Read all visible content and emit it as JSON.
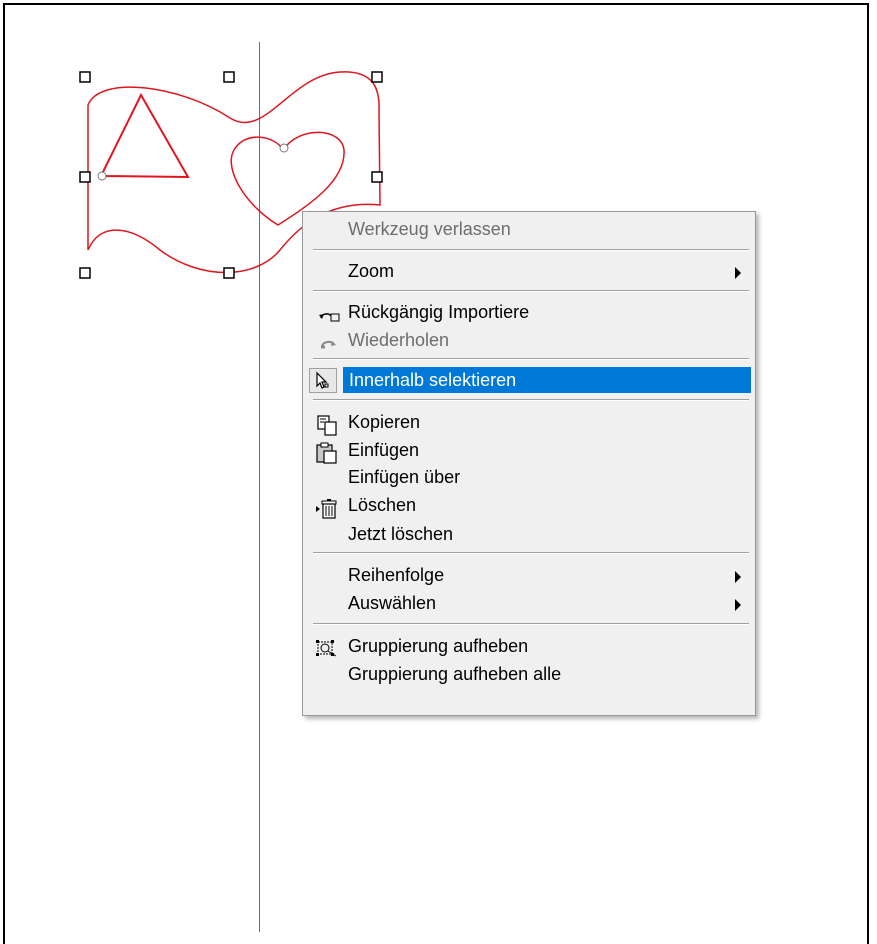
{
  "canvas": {
    "selection_color": "#e0161e",
    "handle_color": "#000000"
  },
  "context_menu": {
    "items": [
      {
        "label": "Werkzeug verlassen",
        "disabled": true
      },
      {
        "label": "Zoom",
        "submenu": true
      },
      {
        "label": "Rückgängig Importiere",
        "icon": "undo-icon"
      },
      {
        "label": "Wiederholen",
        "icon": "redo-icon",
        "disabled": true
      },
      {
        "label": "Innerhalb selektieren",
        "icon": "select-inside-icon",
        "highlighted": true
      },
      {
        "label": "Kopieren",
        "icon": "copy-icon"
      },
      {
        "label": "Einfügen",
        "icon": "paste-icon"
      },
      {
        "label": "Einfügen über"
      },
      {
        "label": "Löschen",
        "icon": "delete-icon"
      },
      {
        "label": "Jetzt löschen"
      },
      {
        "label": "Reihenfolge",
        "submenu": true
      },
      {
        "label": "Auswählen",
        "submenu": true
      },
      {
        "label": "Gruppierung aufheben",
        "icon": "ungroup-icon"
      },
      {
        "label": "Gruppierung aufheben alle"
      }
    ],
    "highlight_color": "#0078d7"
  }
}
